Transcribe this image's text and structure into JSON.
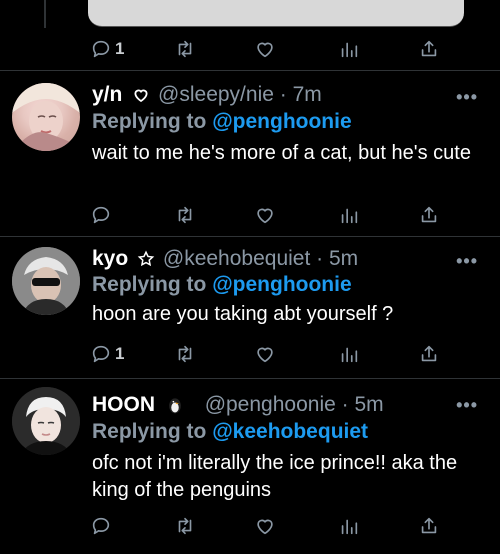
{
  "prev_tweet": {
    "reply_count": "1"
  },
  "tweets": [
    {
      "name": "y/n",
      "handle": "@sleepy/nie",
      "dot": "·",
      "time": "7m",
      "reply_prefix": "Replying to",
      "reply_to": "@penghoonie",
      "text": "wait to me he's more of a cat, but he's cute",
      "reply_count": "",
      "badge_icon": "heart-outline-icon"
    },
    {
      "name": "kyo",
      "handle": "@keehobequiet",
      "dot": "·",
      "time": "5m",
      "reply_prefix": "Replying to",
      "reply_to": "@penghoonie",
      "text": "hoon are you taking abt yourself ?",
      "reply_count": "1",
      "badge_icon": "star-outline-icon"
    },
    {
      "name": "HOON",
      "handle": "@penghoonie",
      "dot": "·",
      "time": "5m",
      "reply_prefix": "Replying to",
      "reply_to": "@keehobequiet",
      "text": "ofc not i'm literally the ice prince!! aka the king of the penguins",
      "reply_count": "",
      "badge_icon": "penguin-icon"
    }
  ],
  "more_label": "•••",
  "colors": {
    "accent": "#1d9bf0",
    "muted": "#8b98a5",
    "bg": "#000000",
    "divider": "#2f3336"
  }
}
